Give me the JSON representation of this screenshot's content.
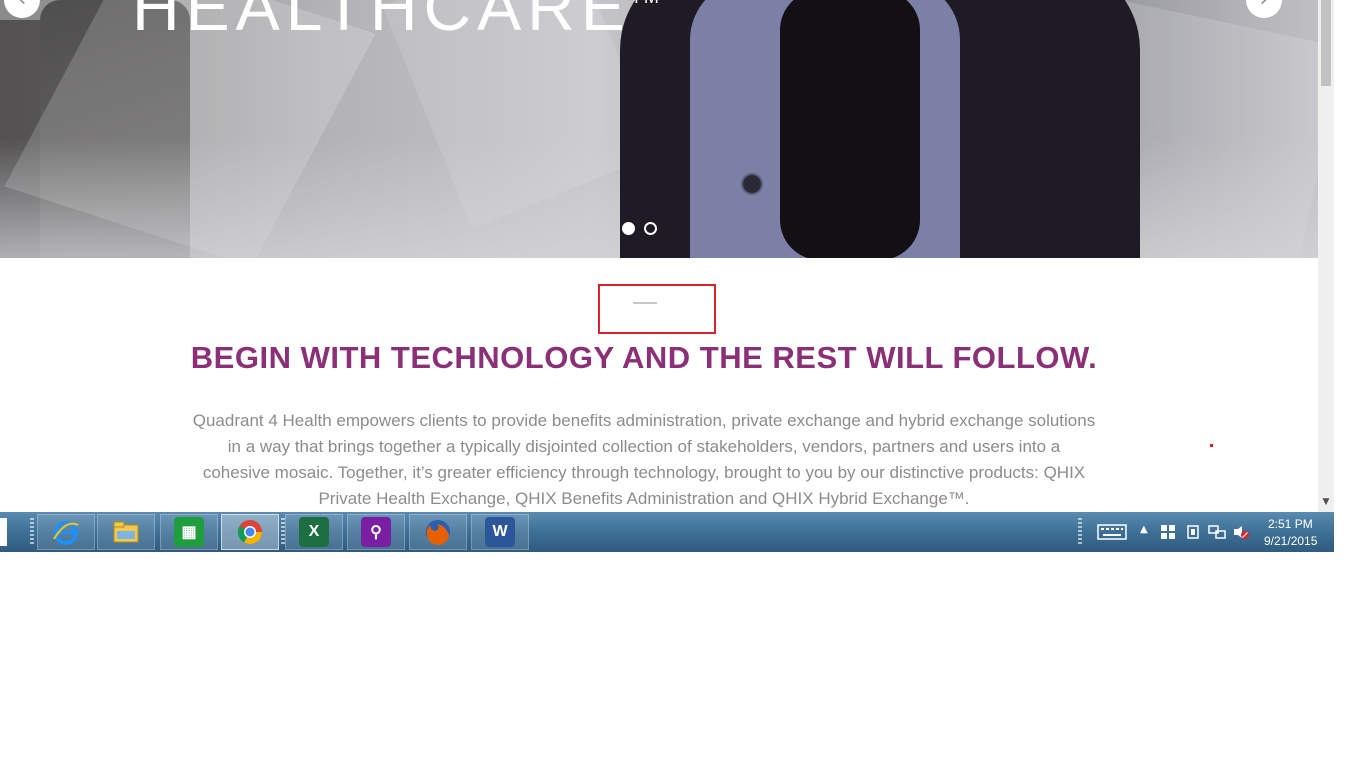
{
  "hero": {
    "title": "HEALTHCARE",
    "trademark": "TM",
    "prev_label": "‹",
    "next_label": "›",
    "slide_count": 2,
    "active_slide": 1
  },
  "section": {
    "headline": "BEGIN WITH TECHNOLOGY AND THE REST WILL FOLLOW.",
    "intro_lines": [
      "Quadrant 4 Health empowers clients to provide benefits administration, private exchange and hybrid exchange solutions",
      "in a way that brings together a typically disjointed collection of stakeholders, vendors, partners and users into a",
      "cohesive mosaic. Together, it’s greater efficiency through technology, brought to you by our distinctive products: QHIX",
      "Private Health Exchange, QHIX Benefits Administration and QHIX Hybrid Exchange™."
    ],
    "headline_color": "#8b2f76",
    "highlight_color": "#d9232d"
  },
  "taskbar": {
    "apps": [
      {
        "name": "internet-explorer-icon"
      },
      {
        "name": "file-explorer-icon"
      },
      {
        "name": "store-icon"
      },
      {
        "name": "chrome-icon",
        "active": true
      },
      {
        "name": "excel-icon"
      },
      {
        "name": "search-app-icon"
      },
      {
        "name": "firefox-icon"
      },
      {
        "name": "word-icon"
      }
    ],
    "clock": {
      "time": "2:51 PM",
      "date": "9/21/2015"
    }
  }
}
